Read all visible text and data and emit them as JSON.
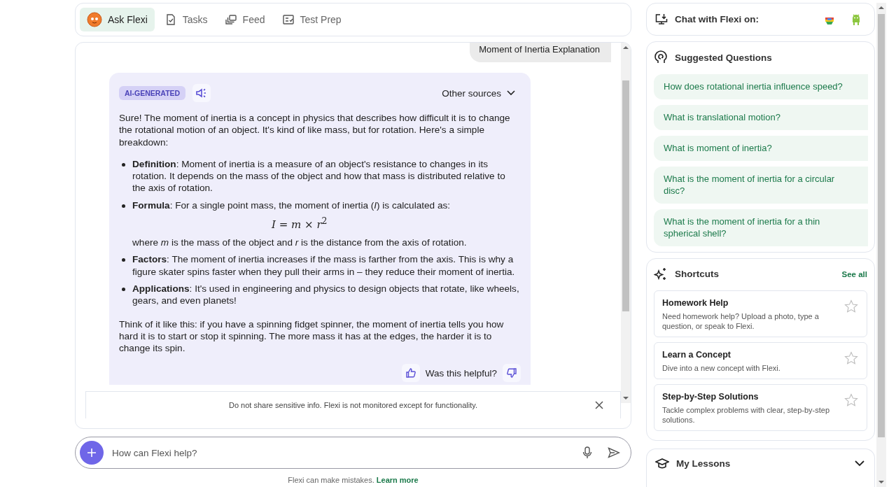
{
  "nav": {
    "tabs": [
      {
        "label": "Ask Flexi",
        "selected": true
      },
      {
        "label": "Tasks",
        "selected": false
      },
      {
        "label": "Feed",
        "selected": false
      },
      {
        "label": "Test Prep",
        "selected": false
      }
    ]
  },
  "chat": {
    "user_message": "Moment of Inertia Explanation",
    "answer": {
      "badge": "AI-GENERATED",
      "sources": "Other sources",
      "intro": "Sure! The moment of inertia is a concept in physics that describes how difficult it is to change the rotational motion of an object. It's kind of like mass, but for rotation. Here's a simple breakdown:",
      "bullets": [
        {
          "text": "**Definition**: Moment of inertia is a measure of an object's resistance to changes in its rotation. It depends on the mass of the object and how that mass is distributed relative to the axis of rotation."
        },
        {
          "text": "**Formula**: For a single point mass, the moment of inertia (*I*) is calculated as:",
          "formula": "*I* = *m* × *r*$^{2}$",
          "note": "where *m* is the mass of the object and *r* is the distance from the axis of rotation."
        },
        {
          "text": "**Factors**: The moment of inertia increases if the mass is farther from the axis. This is why a figure skater spins faster when they pull their arms in – they reduce their moment of inertia."
        },
        {
          "text": "**Applications**: It's used in engineering and physics to design objects that rotate, like wheels, gears, and even planets!"
        }
      ],
      "outro": "Think of it like this: if you have a spinning fidget spinner, the moment of inertia tells you how hard it is to start or stop it spinning. The more mass it has at the edges, the harder it is to change its spin.",
      "feedback": "Was this helpful?"
    },
    "disclaimer": "Do not share sensitive info. Flexi is not monitored except for functionality."
  },
  "input": {
    "placeholder": "How can Flexi help?"
  },
  "footer": {
    "text": "Flexi can make mistakes.",
    "link": "Learn more"
  },
  "sidebar": {
    "chat_on": {
      "title": "Chat with Flexi on:"
    },
    "suggested": {
      "title": "Suggested Questions",
      "questions": [
        "How does rotational inertia influence speed?",
        "What is translational motion?",
        "What is moment of inertia?",
        "What is the moment of inertia for a circular disc?",
        "What is the moment of inertia for a thin spherical shell?"
      ]
    },
    "shortcuts": {
      "title": "Shortcuts",
      "see_all": "See all",
      "items": [
        {
          "title": "Homework Help",
          "description": "Need homework help? Upload a photo, type a question, or speak to Flexi.",
          "starred": false
        },
        {
          "title": "Learn a Concept",
          "description": "Dive into a new concept with Flexi.",
          "starred": false
        },
        {
          "title": "Step-by-Step Solutions",
          "description": "Tackle complex problems with clear, step-by-step solutions.",
          "starred": false
        }
      ]
    },
    "lessons": {
      "title": "My Lessons",
      "expanded": false
    }
  }
}
